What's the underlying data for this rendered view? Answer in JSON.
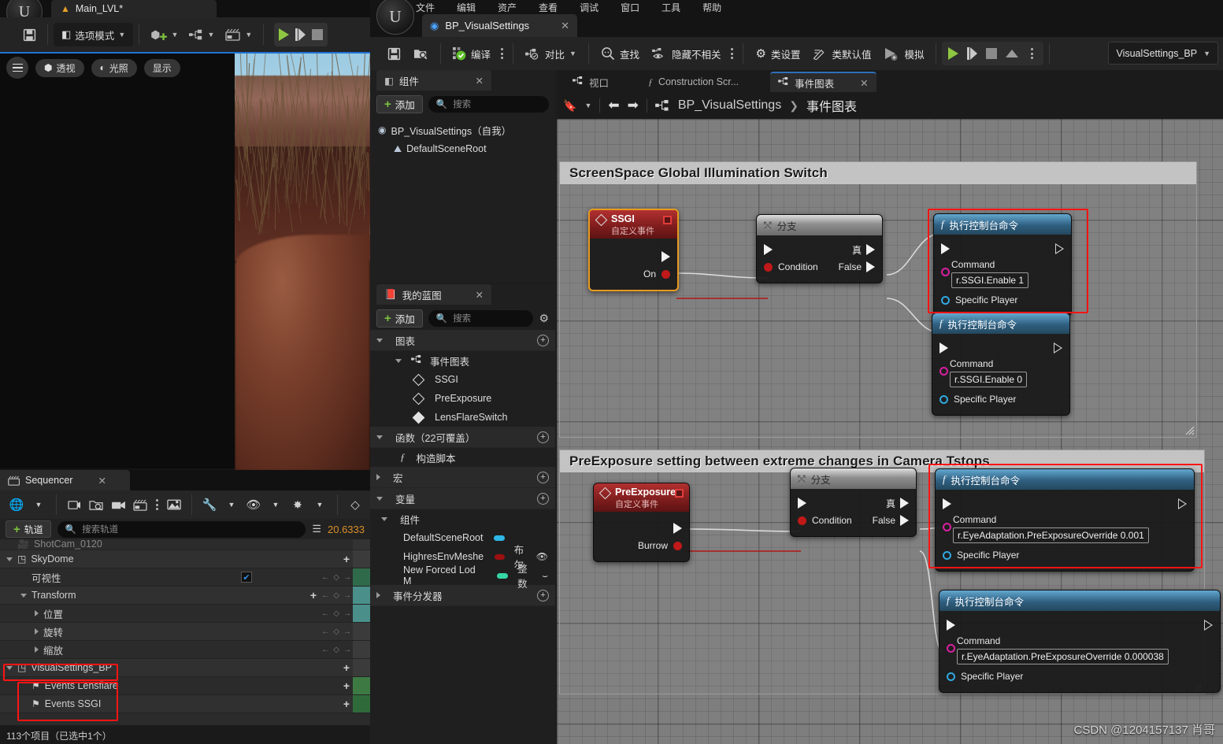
{
  "level_editor": {
    "tab_label": "Main_LVL*",
    "toolbar": {
      "save_icon": "save-icon",
      "mode_label": "选项模式",
      "add_icon": "add-actor-icon",
      "blueprint_icon": "blueprints-icon",
      "cinematics_icon": "cinematics-icon"
    },
    "viewport": {
      "menu_icon": "hamburger-icon",
      "perspective_label": "透视",
      "lighting_label": "光照",
      "show_label": "显示"
    }
  },
  "sequencer": {
    "tab_label": "Sequencer",
    "toolbar_icons": [
      "world-icon",
      "create-camera-icon",
      "open-sequence-icon",
      "camera-cut-icon",
      "clapperboard-icon",
      "kebab-icon",
      "render-icon",
      "wrench-icon",
      "eye-icon",
      "playback-icon",
      "keyframe-icon"
    ],
    "add_track_label": "轨道",
    "search_placeholder": "搜索轨道",
    "filter_icon": "filter-icon",
    "timecode": "20.6333",
    "tracks": [
      {
        "label": "ShotCam_0120",
        "type": "camera",
        "indent": 0
      },
      {
        "label": "SkyDome",
        "type": "actor",
        "indent": 0
      },
      {
        "label": "可视性",
        "type": "bool",
        "indent": 1,
        "checked": true
      },
      {
        "label": "Transform",
        "type": "transform",
        "indent": 1
      },
      {
        "label": "位置",
        "type": "prop",
        "indent": 2
      },
      {
        "label": "旋转",
        "type": "prop",
        "indent": 2
      },
      {
        "label": "缩放",
        "type": "prop",
        "indent": 2
      },
      {
        "label": "VisualSettings_BP",
        "type": "actor",
        "indent": 0,
        "highlighted": true
      },
      {
        "label": "Events Lensflare",
        "type": "event",
        "indent": 1,
        "highlighted": true
      },
      {
        "label": "Events SSGI",
        "type": "event",
        "indent": 1,
        "highlighted": true
      }
    ],
    "status": "113个项目（已选中1个）"
  },
  "blueprint_editor": {
    "menu": [
      "文件",
      "编辑",
      "资产",
      "查看",
      "调试",
      "窗口",
      "工具",
      "帮助"
    ],
    "tab_label": "BP_VisualSettings",
    "toolbar": {
      "save_icon": "save-icon",
      "browse_icon": "browse-icon",
      "compile_label": "编译",
      "diff_label": "对比",
      "find_label": "查找",
      "hide_unrelated_label": "隐藏不相关",
      "class_settings_label": "类设置",
      "class_defaults_label": "类默认值",
      "simulate_label": "模拟",
      "play_icon": "play-icon",
      "step_icon": "step-icon",
      "stop_icon": "stop-icon",
      "eject_icon": "eject-icon",
      "dropdown_value": "VisualSettings_BP"
    },
    "components_panel": {
      "tab_label": "组件",
      "add_label": "添加",
      "search_placeholder": "搜索",
      "tree": [
        {
          "label": "BP_VisualSettings（自我）",
          "icon": "actor-icon",
          "indent": 0
        },
        {
          "label": "DefaultSceneRoot",
          "icon": "scene-root-icon",
          "indent": 1
        }
      ]
    },
    "my_blueprint_panel": {
      "tab_label": "我的蓝图",
      "add_label": "添加",
      "search_placeholder": "搜索",
      "settings_icon": "gear-icon",
      "sections": [
        {
          "label": "图表",
          "type": "section",
          "expanded": true
        },
        {
          "label": "事件图表",
          "type": "graph",
          "indent": 1,
          "expanded": true
        },
        {
          "label": "SSGI",
          "type": "event",
          "indent": 2
        },
        {
          "label": "PreExposure",
          "type": "event",
          "indent": 2
        },
        {
          "label": "LensFlareSwitch",
          "type": "event-filled",
          "indent": 2
        },
        {
          "label": "函数（22可覆盖）",
          "type": "section",
          "expanded": true
        },
        {
          "label": "构造脚本",
          "type": "function",
          "indent": 1
        },
        {
          "label": "宏",
          "type": "section",
          "expanded": false
        },
        {
          "label": "变量",
          "type": "section",
          "expanded": true
        },
        {
          "label": "组件",
          "type": "subsection",
          "indent": 0,
          "expanded": true
        },
        {
          "label": "DefaultSceneRoot",
          "type": "var",
          "indent": 1,
          "pill": "#2fb7e8",
          "vartype": ""
        },
        {
          "label": "HighresEnvMeshe",
          "type": "var",
          "indent": 1,
          "pill": "#9c1010",
          "vartype": "布尔",
          "eye": "visible"
        },
        {
          "label": "New Forced Lod M",
          "type": "var",
          "indent": 1,
          "pill": "#34d6a6",
          "vartype": "整数",
          "eye": "hidden"
        },
        {
          "label": "事件分发器",
          "type": "section",
          "expanded": false
        }
      ]
    },
    "graph_tabs": [
      {
        "label": "视口",
        "icon": "viewport-icon",
        "active": false
      },
      {
        "label": "Construction Scr...",
        "icon": "function-icon",
        "active": false
      },
      {
        "label": "事件图表",
        "icon": "graph-icon",
        "active": true
      }
    ],
    "graph_nav": {
      "bookmark_icon": "bookmark-icon",
      "back_icon": "arrow-left-icon",
      "forward_icon": "arrow-right-icon",
      "breadcrumb_root": "BP_VisualSettings",
      "breadcrumb_sep": "❯",
      "breadcrumb_leaf": "事件图表"
    },
    "comments": [
      {
        "title": "ScreenSpace Global Illumination Switch"
      },
      {
        "title": "PreExposure setting between extreme changes in Camera Tstops"
      }
    ],
    "nodes": [
      {
        "id": "ssgi-event",
        "kind": "event",
        "title": "SSGI",
        "subtitle": "自定义事件",
        "out_exec": "",
        "out_data_label": "On",
        "selected": true
      },
      {
        "id": "branch-1",
        "kind": "branch",
        "title": "分支",
        "condition_label": "Condition",
        "true_label": "真",
        "false_label": "False"
      },
      {
        "id": "console-1",
        "kind": "console",
        "title": "执行控制台命令",
        "command_label": "Command",
        "command_value": "r.SSGI.Enable 1",
        "player_label": "Specific Player",
        "highlighted": true
      },
      {
        "id": "console-2",
        "kind": "console",
        "title": "执行控制台命令",
        "command_label": "Command",
        "command_value": "r.SSGI.Enable 0",
        "player_label": "Specific Player",
        "highlighted": false
      },
      {
        "id": "preexposure-event",
        "kind": "event",
        "title": "PreExposure",
        "subtitle": "自定义事件",
        "out_data_label": "Burrow",
        "selected": false
      },
      {
        "id": "branch-2",
        "kind": "branch",
        "title": "分支",
        "condition_label": "Condition",
        "true_label": "真",
        "false_label": "False"
      },
      {
        "id": "console-3",
        "kind": "console",
        "title": "执行控制台命令",
        "command_label": "Command",
        "command_value": "r.EyeAdaptation.PreExposureOverride 0.001",
        "player_label": "Specific Player",
        "highlighted": true
      },
      {
        "id": "console-4",
        "kind": "console",
        "title": "执行控制台命令",
        "command_label": "Command",
        "command_value": "r.EyeAdaptation.PreExposureOverride 0.000038",
        "player_label": "Specific Player",
        "highlighted": false
      }
    ],
    "watermark": "CSDN @1204157137 肖哥"
  },
  "colors": {
    "accent_red": "#ff1414",
    "play_green": "#8ec642",
    "timecode_orange": "#d98e26",
    "exec_pin": "#f2f2f2",
    "bool_pin": "#c01919",
    "string_pin": "#d81fa0",
    "object_pin": "#2fa8e0"
  }
}
